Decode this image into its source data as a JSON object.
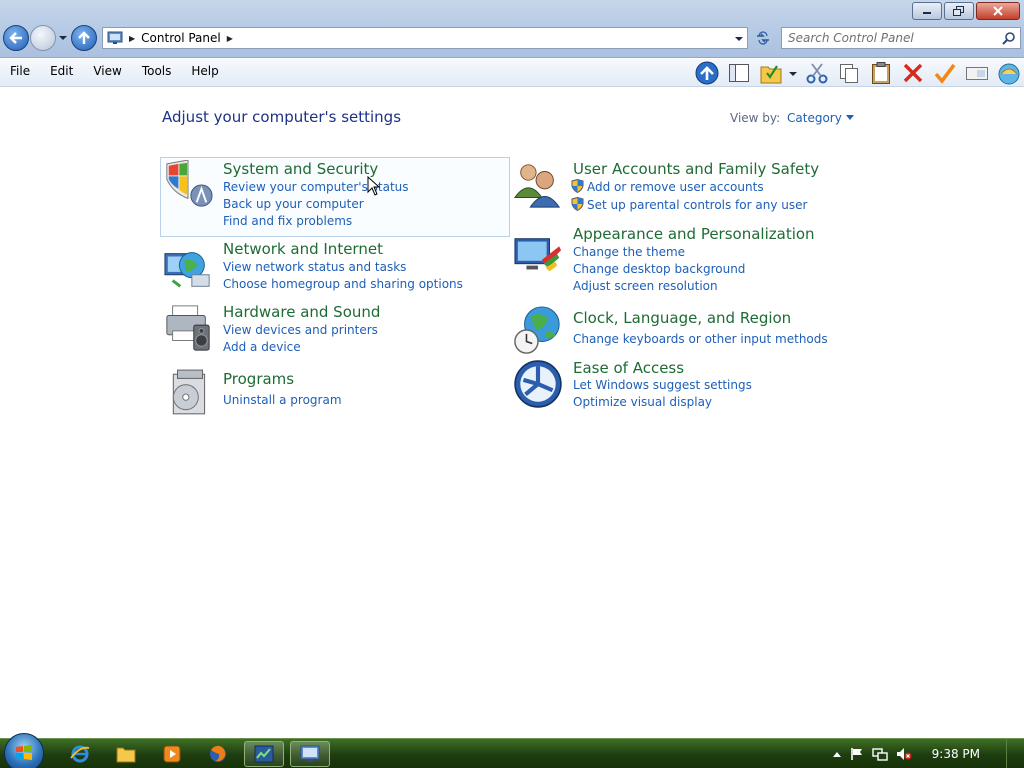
{
  "window": {
    "address_text": "Control Panel",
    "search_placeholder": "Search Control Panel"
  },
  "menu": [
    "File",
    "Edit",
    "View",
    "Tools",
    "Help"
  ],
  "content": {
    "title": "Adjust your computer's settings",
    "viewby_label": "View by:",
    "viewby_value": "Category"
  },
  "categories": {
    "system": {
      "title": "System and Security",
      "links": [
        "Review your computer's status",
        "Back up your computer",
        "Find and fix problems"
      ]
    },
    "network": {
      "title": "Network and Internet",
      "links": [
        "View network status and tasks",
        "Choose homegroup and sharing options"
      ]
    },
    "hardware": {
      "title": "Hardware and Sound",
      "links": [
        "View devices and printers",
        "Add a device"
      ]
    },
    "programs": {
      "title": "Programs",
      "links": [
        "Uninstall a program"
      ]
    },
    "users": {
      "title": "User Accounts and Family Safety",
      "links": [
        "Add or remove user accounts",
        "Set up parental controls for any user"
      ]
    },
    "appearance": {
      "title": "Appearance and Personalization",
      "links": [
        "Change the theme",
        "Change desktop background",
        "Adjust screen resolution"
      ]
    },
    "clock": {
      "title": "Clock, Language, and Region",
      "links": [
        "Change keyboards or other input methods"
      ]
    },
    "ease": {
      "title": "Ease of Access",
      "links": [
        "Let Windows suggest settings",
        "Optimize visual display"
      ]
    }
  },
  "taskbar": {
    "clock": "9:38 PM"
  },
  "colors": {
    "category_title": "#1f6b35",
    "link": "#1e5fb7",
    "heading": "#1e3287",
    "taskbar": "#1e3d10"
  }
}
